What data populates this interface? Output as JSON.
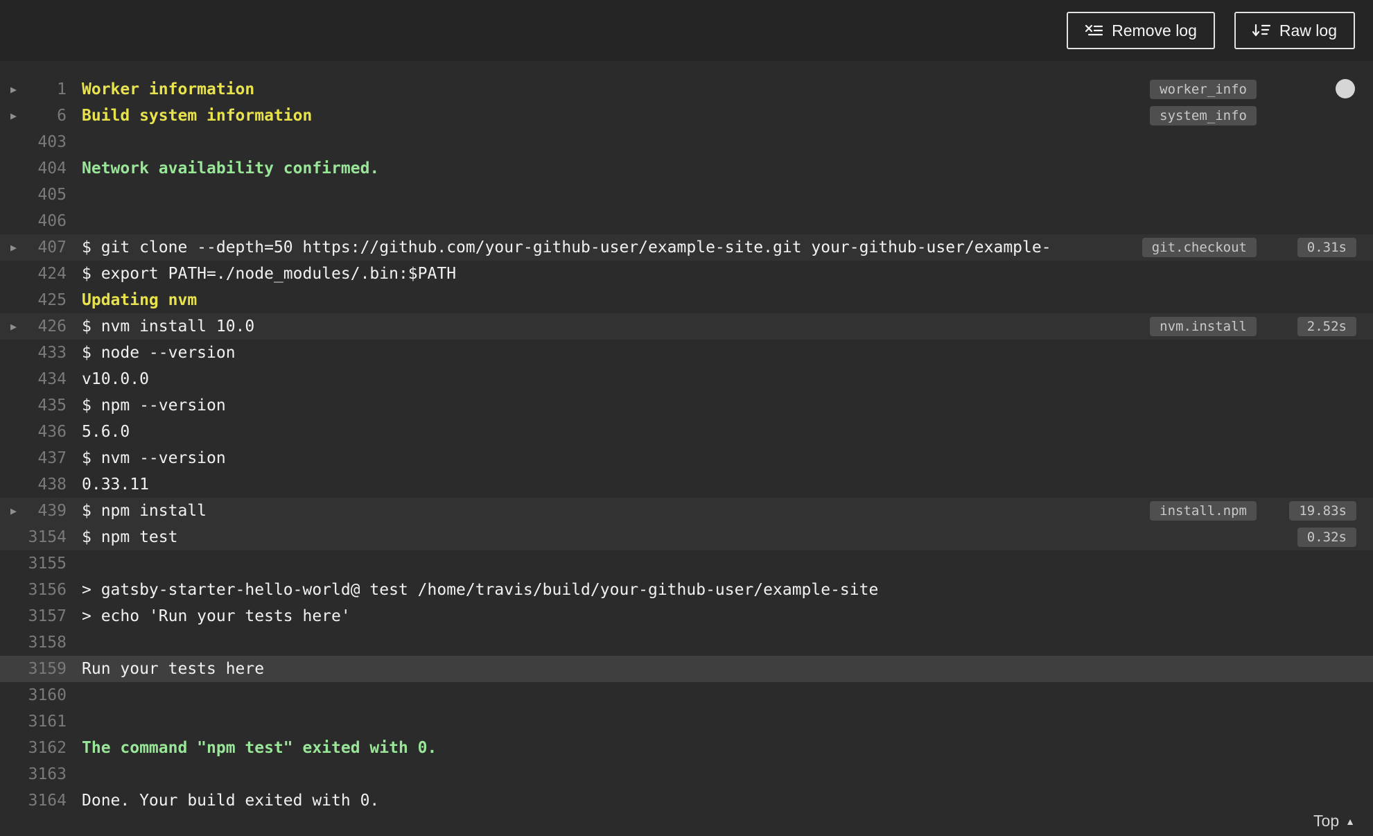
{
  "toolbar": {
    "remove_log_label": "Remove log",
    "raw_log_label": "Raw log"
  },
  "footer": {
    "top_label": "Top"
  },
  "icons": {
    "fold_arrow": "▶",
    "top_arrow": "▲"
  },
  "colors": {
    "section_yellow": "#e8e24c",
    "success_green": "#99e699",
    "badge_bg": "#4f4f4f",
    "row_highlight": "#323232",
    "row_selected": "#3f3f3f",
    "log_bg": "#2b2b2b",
    "topbar_bg": "#252525"
  },
  "log": {
    "rows": [
      {
        "n": 1,
        "text": "Worker information",
        "style": "yellow",
        "fold": true,
        "badge": "worker_info"
      },
      {
        "n": 6,
        "text": "Build system information",
        "style": "yellow",
        "fold": true,
        "badge": "system_info"
      },
      {
        "n": 403,
        "text": ""
      },
      {
        "n": 404,
        "text": "Network availability confirmed.",
        "style": "green"
      },
      {
        "n": 405,
        "text": ""
      },
      {
        "n": 406,
        "text": ""
      },
      {
        "n": 407,
        "text": "$ git clone --depth=50 https://github.com/your-github-user/example-site.git your-github-user/example-",
        "fold": true,
        "badge": "git.checkout",
        "dur": "0.31s",
        "hl": true
      },
      {
        "n": 424,
        "text": "$ export PATH=./node_modules/.bin:$PATH"
      },
      {
        "n": 425,
        "text": "Updating nvm",
        "style": "yellow"
      },
      {
        "n": 426,
        "text": "$ nvm install 10.0",
        "fold": true,
        "badge": "nvm.install",
        "dur": "2.52s",
        "hl": true
      },
      {
        "n": 433,
        "text": "$ node --version"
      },
      {
        "n": 434,
        "text": "v10.0.0"
      },
      {
        "n": 435,
        "text": "$ npm --version"
      },
      {
        "n": 436,
        "text": "5.6.0"
      },
      {
        "n": 437,
        "text": "$ nvm --version"
      },
      {
        "n": 438,
        "text": "0.33.11"
      },
      {
        "n": 439,
        "text": "$ npm install",
        "fold": true,
        "badge": "install.npm",
        "dur": "19.83s",
        "hl": true
      },
      {
        "n": 3154,
        "text": "$ npm test",
        "dur": "0.32s",
        "hl": true
      },
      {
        "n": 3155,
        "text": ""
      },
      {
        "n": 3156,
        "text": "> gatsby-starter-hello-world@ test /home/travis/build/your-github-user/example-site"
      },
      {
        "n": 3157,
        "text": "> echo 'Run your tests here'"
      },
      {
        "n": 3158,
        "text": ""
      },
      {
        "n": 3159,
        "text": "Run your tests here",
        "sel": true
      },
      {
        "n": 3160,
        "text": ""
      },
      {
        "n": 3161,
        "text": ""
      },
      {
        "n": 3162,
        "text": "The command \"npm test\" exited with 0.",
        "style": "green"
      },
      {
        "n": 3163,
        "text": ""
      },
      {
        "n": 3164,
        "text": "Done. Your build exited with 0."
      }
    ]
  }
}
